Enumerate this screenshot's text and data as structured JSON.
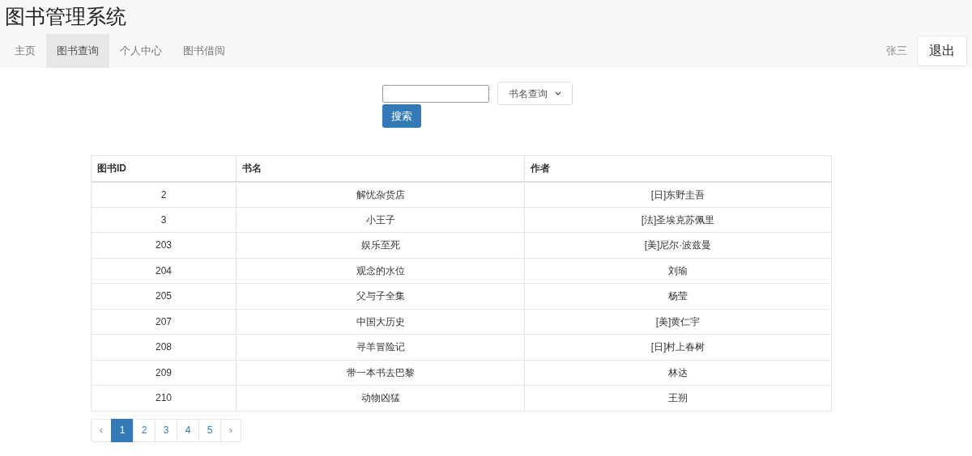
{
  "app_title": "图书管理系统",
  "nav": [
    {
      "label": "主页",
      "selected": false
    },
    {
      "label": "图书查询",
      "selected": true
    },
    {
      "label": "个人中心",
      "selected": false
    },
    {
      "label": "图书借阅",
      "selected": false
    }
  ],
  "user": "张三",
  "logout": "退出",
  "search": {
    "select": "书名查询",
    "button": "搜索"
  },
  "table": {
    "columns": [
      "图书ID",
      "书名",
      "作者"
    ],
    "rows": [
      [
        "2",
        "解忧杂货店",
        "[日]东野圭吾"
      ],
      [
        "3",
        "小王子",
        "[法]圣埃克苏佩里"
      ],
      [
        "203",
        "娱乐至死",
        "[美]尼尔·波兹曼"
      ],
      [
        "204",
        "观念的水位",
        "刘瑜"
      ],
      [
        "205",
        "父与子全集",
        "杨莹"
      ],
      [
        "207",
        "中国大历史",
        "[美]黄仁宇"
      ],
      [
        "208",
        "寻羊冒险记",
        "[日]村上春树"
      ],
      [
        "209",
        "带一本书去巴黎",
        "林达"
      ],
      [
        "210",
        "动物凶猛",
        "王朔"
      ]
    ]
  },
  "pagination": {
    "prev": "‹",
    "next": "›",
    "pages": [
      {
        "label": "1",
        "selected": true
      },
      {
        "label": "2",
        "selected": false
      },
      {
        "label": "3",
        "selected": false
      },
      {
        "label": "4",
        "selected": false
      },
      {
        "label": "5",
        "selected": false
      }
    ]
  }
}
